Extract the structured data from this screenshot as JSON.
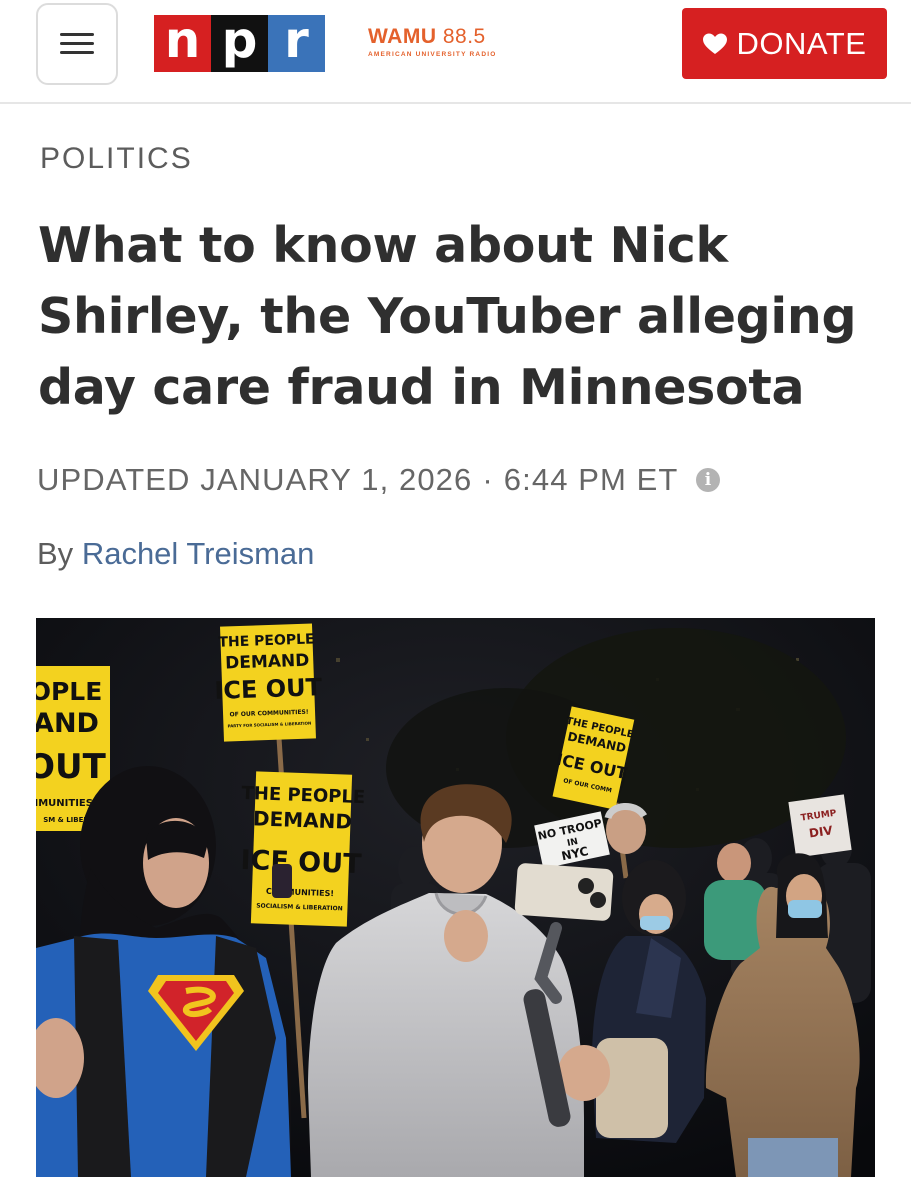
{
  "header": {
    "menu_icon": "hamburger-menu-icon",
    "logo": {
      "letters": [
        "n",
        "p",
        "r"
      ],
      "colors": [
        "#d62021",
        "#111111",
        "#3a73b9"
      ]
    },
    "station": {
      "name": "WAMU",
      "frequency": "88.5",
      "tagline": "AMERICAN UNIVERSITY RADIO"
    },
    "donate": {
      "icon": "heart-icon",
      "label": "DONATE"
    }
  },
  "article": {
    "section": "POLITICS",
    "headline": "What to know about Nick Shirley, the YouTuber alleging day care fraud in Minnesota",
    "updated": "UPDATED JANUARY 1, 2026",
    "separator": "·",
    "time": "6:44 PM ET",
    "byline_prefix": "By",
    "author": "Rachel Treisman"
  },
  "photo": {
    "signs": [
      {
        "lines": [
          "OPLE",
          "AND",
          "OUT",
          "IMUNITIES!",
          "SM & LIBER"
        ]
      },
      {
        "lines": [
          "THE PEOPLE",
          "DEMAND",
          "ICE OUT",
          "OF OUR COMMUNITIES!",
          "PARTY FOR SOCIALISM & LIBERATION"
        ]
      },
      {
        "lines": [
          "THE PEOPLE",
          "DEMAND",
          "ICE OUT",
          "COMMUNITIES!",
          "SOCIALISM & LIBERATION"
        ]
      },
      {
        "lines": [
          "THE PEOPLE",
          "DEMAND",
          "ICE OUT",
          "OF OUR COMM"
        ]
      },
      {
        "lines": [
          "NO TROOP",
          "IN",
          "NYC"
        ]
      },
      {
        "lines": [
          "TRUMP",
          "DIV"
        ]
      }
    ]
  },
  "colors": {
    "npr_red": "#d62021",
    "npr_black": "#111111",
    "npr_blue": "#3a73b9",
    "wamu_orange": "#e4612c",
    "donate_red": "#d62021",
    "author_link": "#4a6b96",
    "sign_yellow": "#f3d21f"
  }
}
